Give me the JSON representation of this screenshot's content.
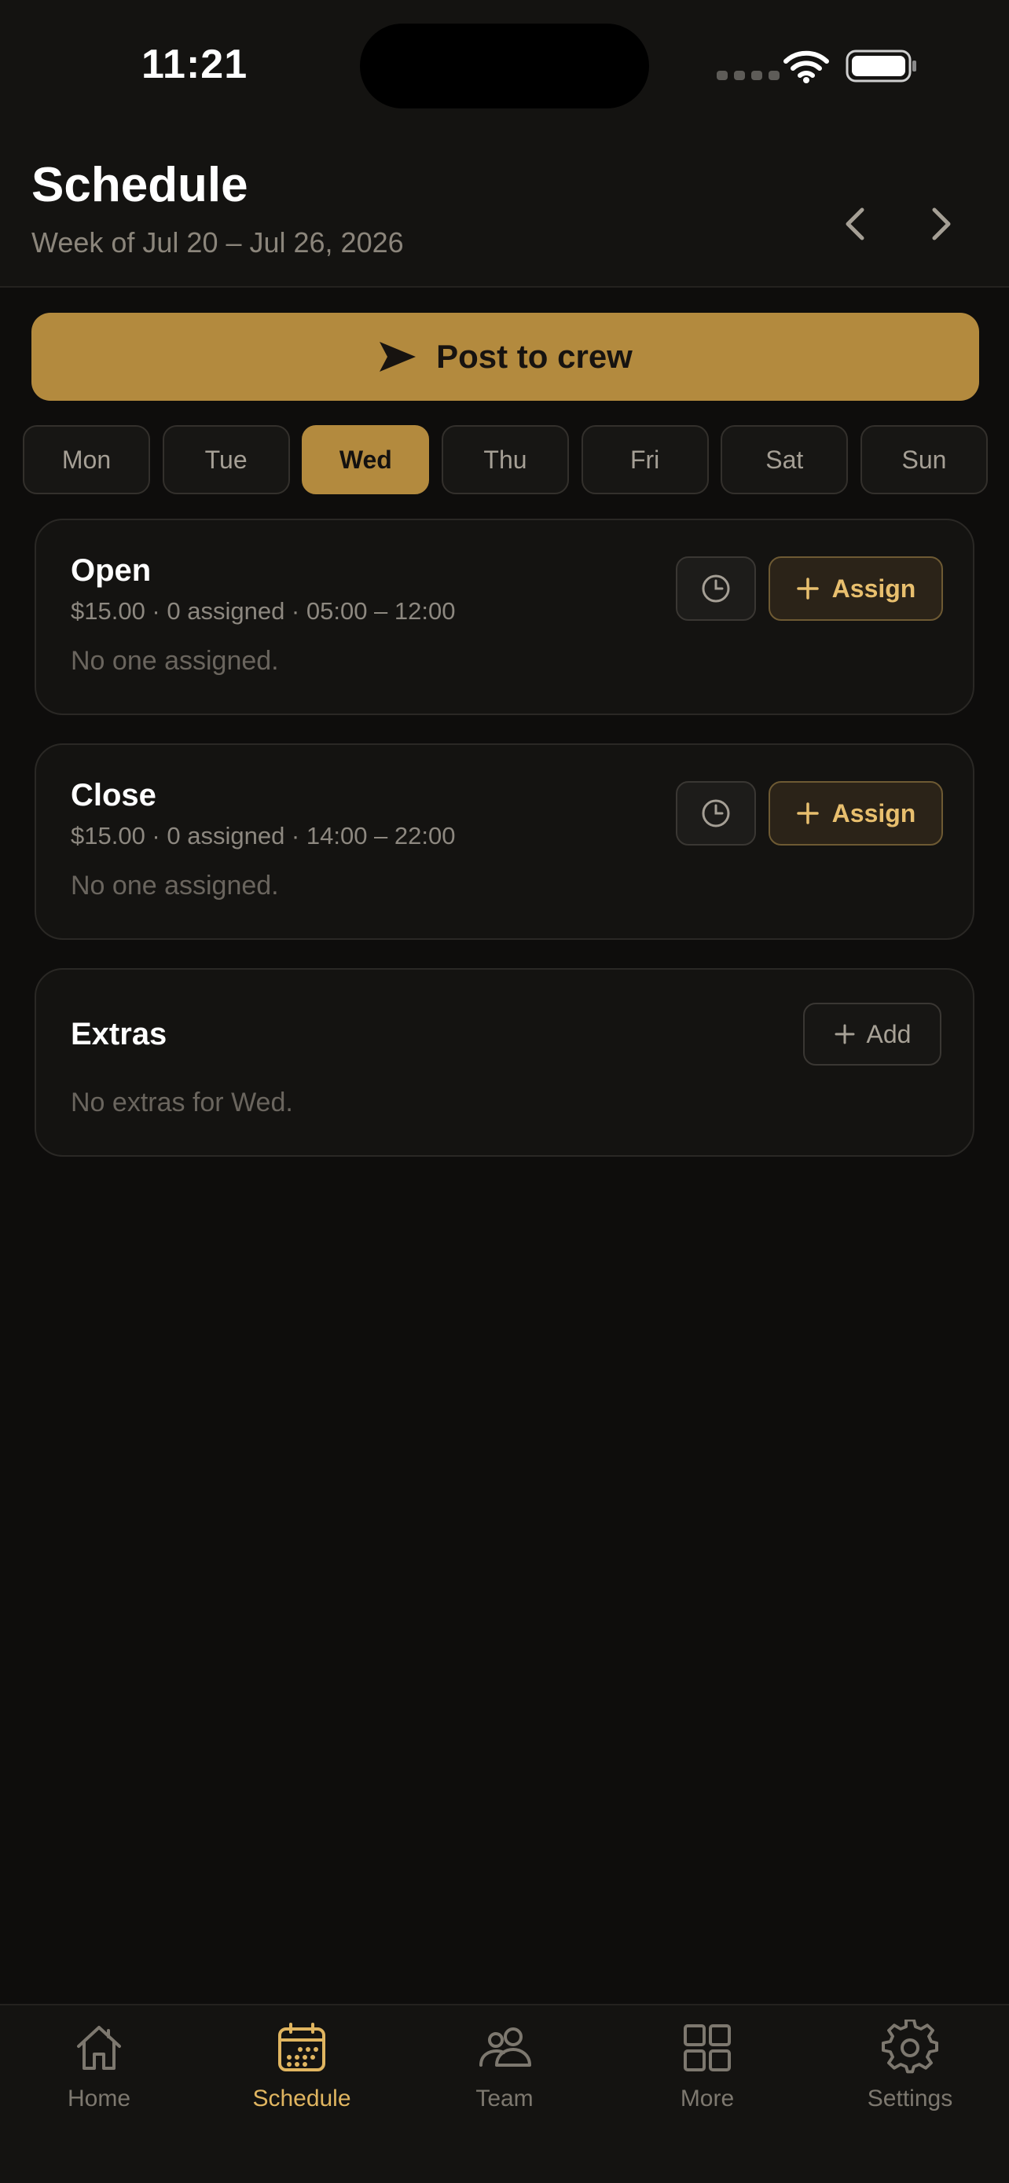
{
  "status_bar": {
    "time": "11:21"
  },
  "header": {
    "title": "Schedule",
    "subtitle": "Week of Jul 20 – Jul 26, 2026"
  },
  "post_button": {
    "label": "Post to crew"
  },
  "days": [
    "Mon",
    "Tue",
    "Wed",
    "Thu",
    "Fri",
    "Sat",
    "Sun"
  ],
  "selected_day": "Wed",
  "shifts": [
    {
      "title": "Open",
      "meta": "$15.00 · 0 assigned · 05:00 – 12:00",
      "empty_text": "No one assigned.",
      "assign_label": "Assign"
    },
    {
      "title": "Close",
      "meta": "$15.00 · 0 assigned · 14:00 – 22:00",
      "empty_text": "No one assigned.",
      "assign_label": "Assign"
    }
  ],
  "extras": {
    "title": "Extras",
    "add_label": "Add",
    "empty_text": "No extras for Wed."
  },
  "tabbar": {
    "active": "Schedule",
    "items": [
      {
        "label": "Home",
        "icon": "home-icon"
      },
      {
        "label": "Schedule",
        "icon": "calendar-icon"
      },
      {
        "label": "Team",
        "icon": "team-icon"
      },
      {
        "label": "More",
        "icon": "grid-icon"
      },
      {
        "label": "Settings",
        "icon": "gear-icon"
      }
    ]
  },
  "colors": {
    "accent": "#b38a3e",
    "accent_text": "#e0b560",
    "background": "#0e0d0c",
    "card": "#141311"
  }
}
